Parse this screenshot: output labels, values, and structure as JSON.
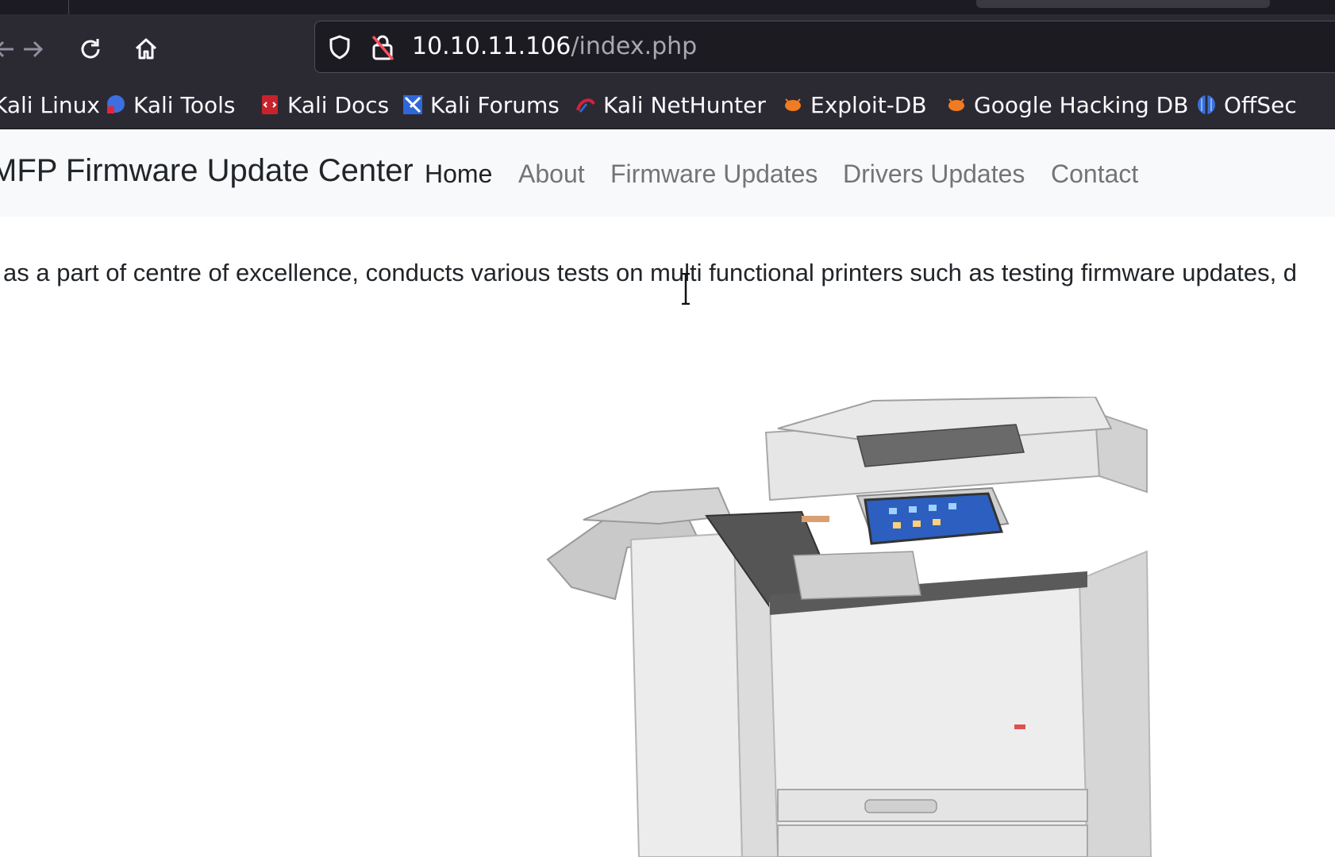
{
  "browser": {
    "url_host": "10.10.11.106",
    "url_path": "/index.php",
    "nav_icons": [
      "back-arrow-icon",
      "forward-arrow-icon",
      "reload-icon",
      "home-icon",
      "shield-icon",
      "insecure-lock-icon"
    ],
    "bookmarks": [
      {
        "label": "Kali Linux",
        "icon": "kali-dragon-icon"
      },
      {
        "label": "Kali Tools",
        "icon": "kali-tools-icon"
      },
      {
        "label": "Kali Docs",
        "icon": "kali-docs-icon"
      },
      {
        "label": "Kali Forums",
        "icon": "kali-forums-icon"
      },
      {
        "label": "Kali NetHunter",
        "icon": "kali-nethunter-icon"
      },
      {
        "label": "Exploit-DB",
        "icon": "exploit-db-icon"
      },
      {
        "label": "Google Hacking DB",
        "icon": "google-hacking-db-icon"
      },
      {
        "label": "OffSec",
        "icon": "offsec-icon"
      }
    ]
  },
  "site": {
    "brand": "MFP Firmware Update Center",
    "nav": [
      "Home",
      "About",
      "Firmware Updates",
      "Drivers Updates",
      "Contact"
    ],
    "active_nav": "Home",
    "intro_text": "as a part of centre of excellence, conducts various tests on multi functional printers such as testing firmware updates, d",
    "image": "multifunction-printer-image"
  },
  "colors": {
    "chrome_bg": "#2b2a33",
    "url_bg": "#1c1b22",
    "site_nav_bg": "#f8f9fa",
    "active_link": "#1f2326",
    "inactive_link": "#727578"
  }
}
